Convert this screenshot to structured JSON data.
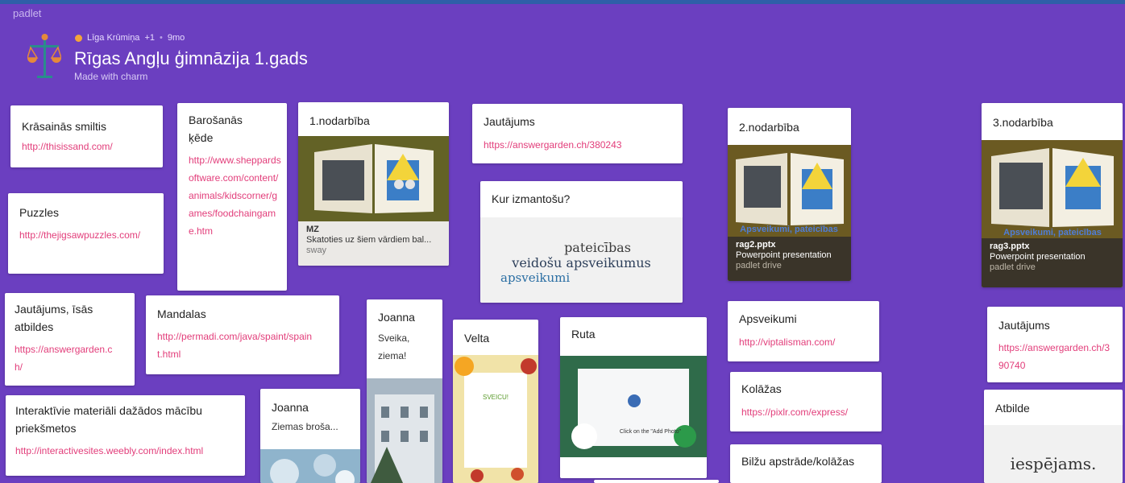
{
  "brand": "padlet",
  "header": {
    "author": "Līga Krūmiņa",
    "plus": "+1",
    "sep": "•",
    "time": "9mo",
    "title": "Rīgas Angļu ģimnāzija 1.gads",
    "subtitle": "Made with charm"
  },
  "colors": {
    "background": "#6b3fc0",
    "link": "#e23d7a",
    "topbar": "#2e5fa8"
  },
  "cards": {
    "krasainas": {
      "title": "Krāsainās smiltis",
      "link": "http://thisissand.com/"
    },
    "puzzles": {
      "title": "Puzzles",
      "link": "http://thejigsawpuzzles.com/"
    },
    "barosanas": {
      "title": "Barošanās ķēde",
      "link": "http://www.sheppardsoftware.com/content/animals/kidscorner/games/foodchaingame.htm"
    },
    "nod1": {
      "title": "1.nodarbība",
      "foot_title": "MZ",
      "foot_text": "Skatoties uz šiem vārdiem bal...",
      "foot_meta": "sway"
    },
    "jautajums1": {
      "title": "Jautājums",
      "link": "https://answergarden.ch/380243"
    },
    "kur": {
      "title": "Kur izmantošu?",
      "cloud_big1": "pateicības",
      "cloud_big2": "veidošu apsveikumus",
      "cloud_big3": "apsveikumi"
    },
    "nod2": {
      "title": "2.nodarbība",
      "file": "rag2.pptx",
      "type": "Powerpoint presentation",
      "src": "padlet drive"
    },
    "nod3": {
      "title": "3.nodarbība",
      "file": "rag3.pptx",
      "type": "Powerpoint presentation",
      "src": "padlet drive"
    },
    "jautajumsisas": {
      "title": "Jautājums, īsās atbildes",
      "link": "https://answergarden.ch/"
    },
    "mandalas": {
      "title": "Mandalas",
      "link": "http://permadi.com/java/spaint/spaint.html"
    },
    "joanna1": {
      "title": "Joanna",
      "text": "Sveika, ziema!"
    },
    "velta": {
      "title": "Velta"
    },
    "ruta": {
      "title": "Ruta"
    },
    "apsveikumi": {
      "title": "Apsveikumi",
      "link": "http://viptalisman.com/"
    },
    "jautajums2": {
      "title": "Jautājums",
      "link": "https://answergarden.ch/390740"
    },
    "interaktivie": {
      "title": "Interaktīvie materiāli dažādos mācību priekšmetos",
      "link": "http://interactivesites.weebly.com/index.html"
    },
    "joanna2": {
      "title": "Joanna",
      "text": "Ziemas broša..."
    },
    "kolazas": {
      "title": "Kolāžas",
      "link": "https://pixlr.com/express/"
    },
    "bilzu": {
      "title": "Bilžu apstrāde/kolāžas"
    },
    "atbilde": {
      "title": "Atbilde",
      "cloud_big": "iespējams."
    }
  },
  "image_labels": {
    "book_banner": "Apsveikumi, pateicības",
    "sveicu": "SVEICU!",
    "click_photo": "Click on the \"Add Photo\""
  }
}
